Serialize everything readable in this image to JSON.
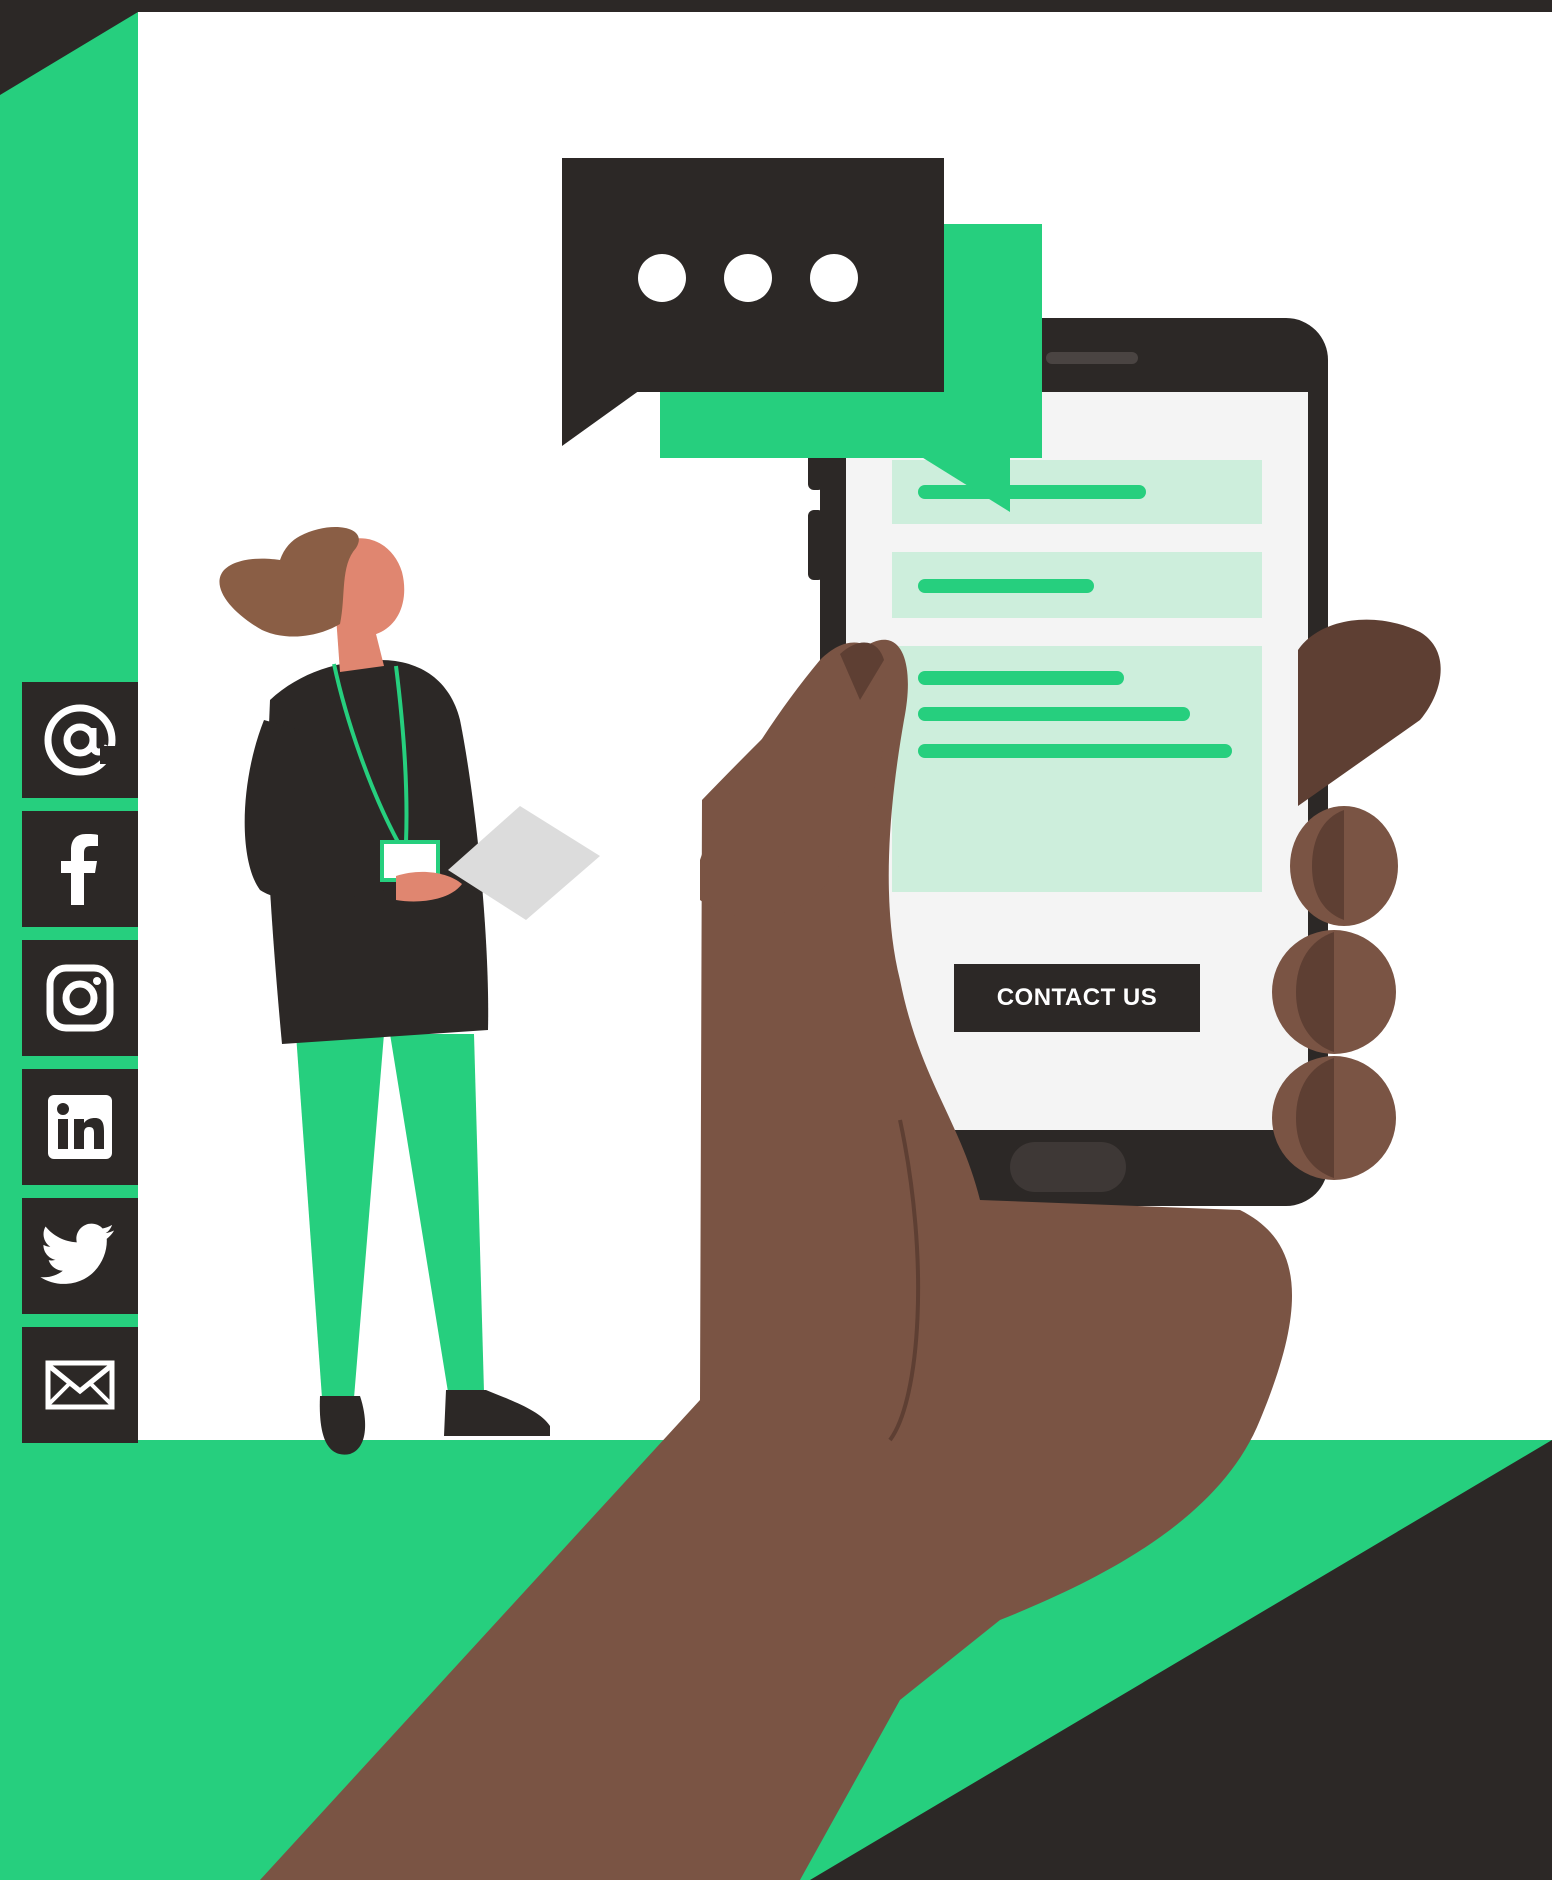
{
  "colors": {
    "green": "#26cf7e",
    "dark": "#2c2826",
    "light_green": "#cdeedc",
    "screen": "#f4f4f4",
    "skin_dark": "#7a5444",
    "skin_shade": "#5e3f33",
    "hair": "#8a5e45",
    "skin_light": "#e08670",
    "paper": "#dcdcdc",
    "white": "#ffffff"
  },
  "social": {
    "items": [
      {
        "icon": "at-sign-icon"
      },
      {
        "icon": "facebook-icon"
      },
      {
        "icon": "instagram-icon"
      },
      {
        "icon": "linkedin-icon"
      },
      {
        "icon": "twitter-icon"
      },
      {
        "icon": "mail-icon"
      }
    ]
  },
  "phone": {
    "contact_label": "CONTACT US"
  }
}
